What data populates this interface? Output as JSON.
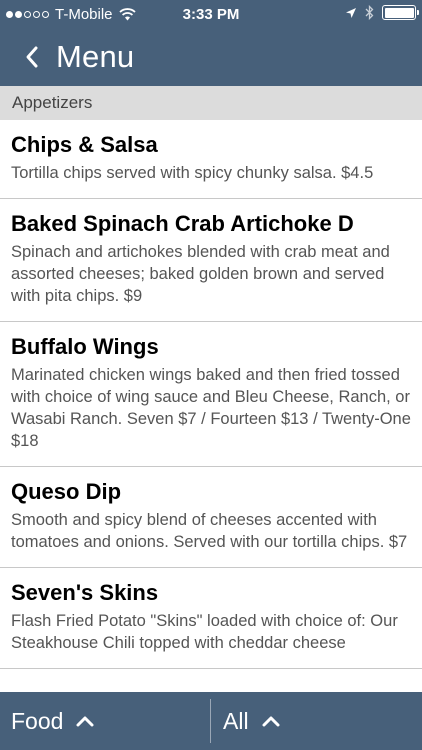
{
  "status_bar": {
    "carrier": "T-Mobile",
    "time": "3:33 PM",
    "signal_bars_filled": 2,
    "signal_bars_total": 5
  },
  "nav": {
    "back_icon": "chevron-left-icon",
    "title": "Menu"
  },
  "section": {
    "title": "Appetizers"
  },
  "items": [
    {
      "name": "Chips & Salsa",
      "description": "Tortilla chips served with spicy chunky salsa. $4.5"
    },
    {
      "name": " Baked Spinach Crab Artichoke D",
      "description": "Spinach and artichokes blended with crab meat and assorted cheeses; baked golden brown and served with pita chips. $9"
    },
    {
      "name": "Buffalo Wings",
      "description": "Marinated chicken wings baked and then fried tossed with choice of wing sauce and Bleu Cheese, Ranch, or Wasabi Ranch. Seven $7 / Fourteen $13 / Twenty-One $18"
    },
    {
      "name": "Queso Dip",
      "description": "Smooth and spicy blend of cheeses accented with tomatoes and onions. Served with our tortilla chips. $7"
    },
    {
      "name": "Seven's Skins",
      "description": "Flash Fried Potato \"Skins\" loaded with choice of: Our Steakhouse Chili topped with cheddar cheese"
    }
  ],
  "bottom_bar": {
    "left_label": "Food",
    "right_label": "All"
  },
  "colors": {
    "bar": "#47607a",
    "section": "#dcdcdc"
  }
}
